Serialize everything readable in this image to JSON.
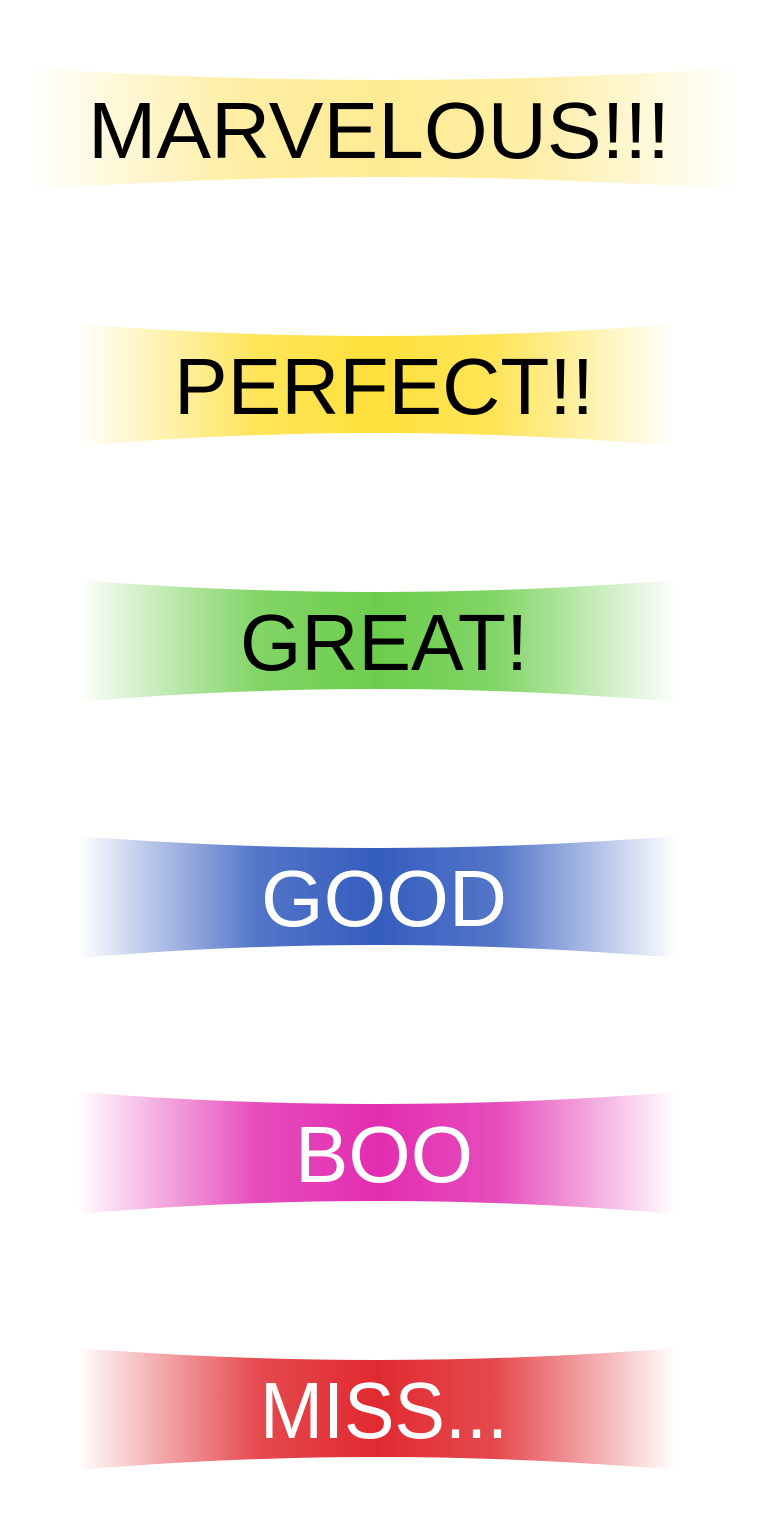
{
  "judgments": [
    {
      "label": "MARVELOUS!!!",
      "color": "#ffeb94",
      "text_color": "#000000",
      "wide": true
    },
    {
      "label": "PERFECT!!",
      "color": "#ffe03c",
      "text_color": "#000000",
      "wide": false
    },
    {
      "label": "GREAT!",
      "color": "#6ccd4c",
      "text_color": "#000000",
      "wide": false
    },
    {
      "label": "GOOD",
      "color": "#355dbf",
      "text_color": "#ffffff",
      "wide": false
    },
    {
      "label": "BOO",
      "color": "#e22db0",
      "text_color": "#ffffff",
      "wide": false
    },
    {
      "label": "MISS...",
      "color": "#e02a30",
      "text_color": "#ffffff",
      "wide": false
    }
  ]
}
